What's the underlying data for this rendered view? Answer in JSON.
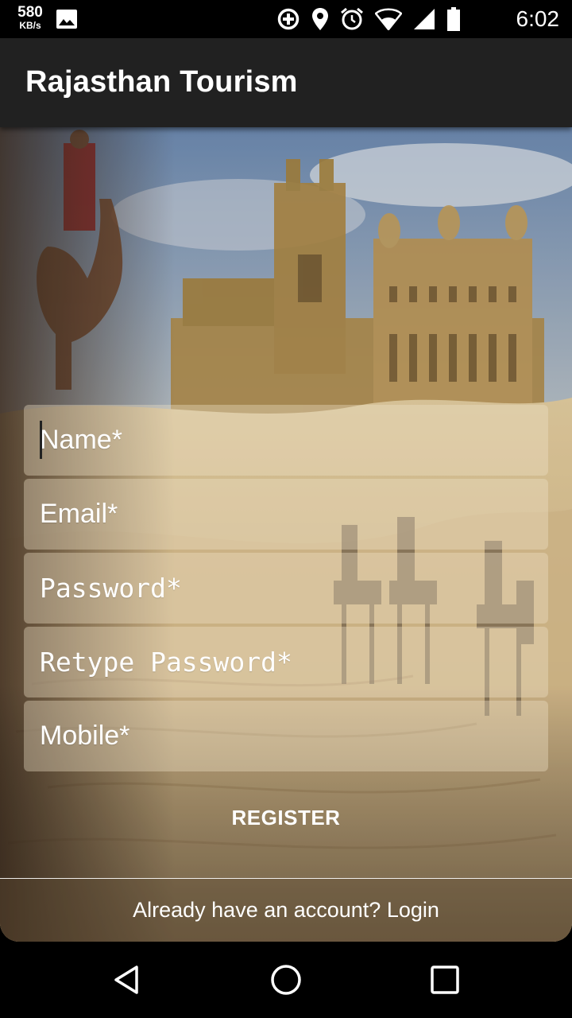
{
  "status_bar": {
    "net_speed_value": "580",
    "net_speed_unit": "KB/s",
    "time": "6:02",
    "icons": [
      "image-icon",
      "data-saver-icon",
      "location-icon",
      "alarm-icon",
      "wifi-icon",
      "signal-icon",
      "battery-icon"
    ]
  },
  "app_bar": {
    "title": "Rajasthan Tourism",
    "background": "#212121"
  },
  "form": {
    "name_placeholder": "Name*",
    "email_placeholder": "Email*",
    "password_placeholder": "Password*",
    "retype_password_placeholder": "Retype Password*",
    "mobile_placeholder": "Mobile*"
  },
  "actions": {
    "register_label": "REGISTER",
    "login_prompt": "Already have an account? Login"
  },
  "nav_bar": {
    "icons": [
      "back-icon",
      "home-icon",
      "recents-icon"
    ]
  }
}
